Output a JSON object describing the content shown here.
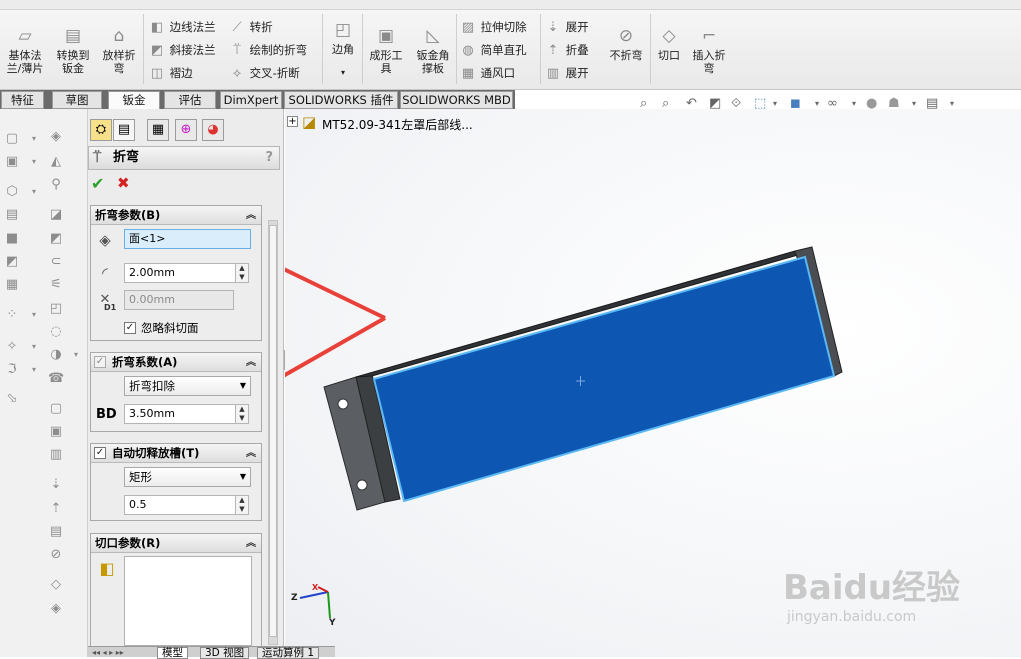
{
  "ribbon": {
    "big_buttons": [
      {
        "label": "基体法\n兰/薄片",
        "icon": "base-flange-icon"
      },
      {
        "label": "转换到\n钣金",
        "icon": "convert-to-sheetmetal-icon"
      },
      {
        "label": "放样折\n弯",
        "icon": "lofted-bend-icon"
      }
    ],
    "col1": [
      "边线法兰",
      "斜接法兰",
      "褶边"
    ],
    "col2": [
      "转折",
      "绘制的折弯",
      "交叉-折断"
    ],
    "corner_label": "边角",
    "tools": [
      {
        "label": "成形工\n具",
        "icon": "forming-tool-icon"
      },
      {
        "label": "钣金角\n撑板",
        "icon": "sheetmetal-gusset-icon"
      }
    ],
    "col3": [
      "拉伸切除",
      "简单直孔",
      "通风口"
    ],
    "col4": [
      "展开",
      "折叠",
      "展开"
    ],
    "tail_buttons": [
      {
        "label": "不折弯",
        "icon": "no-bends-icon"
      },
      {
        "label": "切口",
        "icon": "rip-icon"
      },
      {
        "label": "插入折\n弯",
        "icon": "insert-bends-icon"
      }
    ]
  },
  "tabs": [
    "特征",
    "草图",
    "钣金",
    "评估",
    "DimXpert",
    "SOLIDWORKS 插件",
    "SOLIDWORKS MBD"
  ],
  "active_tab": "钣金",
  "tree": {
    "model_name": "MT52.09-341左罩后部线..."
  },
  "pm": {
    "title": "折弯",
    "help": "?",
    "ok": "✔",
    "cancel": "✖",
    "bend_params": {
      "header": "折弯参数(B)",
      "face": "面<1>",
      "radius": "2.00mm",
      "d1": "0.00mm",
      "d1_tag": "D1",
      "ignore_bevel": "忽略斜切面",
      "ignore_bevel_checked": true
    },
    "bend_allowance": {
      "header": "折弯系数(A)",
      "type": "折弯扣除",
      "bd_label": "BD",
      "bd_value": "3.50mm"
    },
    "auto_relief": {
      "header": "自动切释放槽(T)",
      "type": "矩形",
      "ratio": "0.5"
    },
    "rip_params": {
      "header": "切口参数(R)"
    }
  },
  "bottom_tabs": [
    "模型",
    "3D 视图",
    "运动算例 1"
  ],
  "triad": {
    "x": "X",
    "y": "Y",
    "z": "Z"
  },
  "watermark": {
    "brand": "Baidu经验",
    "url": "jingyan.baidu.com"
  },
  "colors": {
    "face_blue": "#0d56b1",
    "arrow_red": "#e8413a",
    "selection_cyan": "#5bb8f5"
  }
}
